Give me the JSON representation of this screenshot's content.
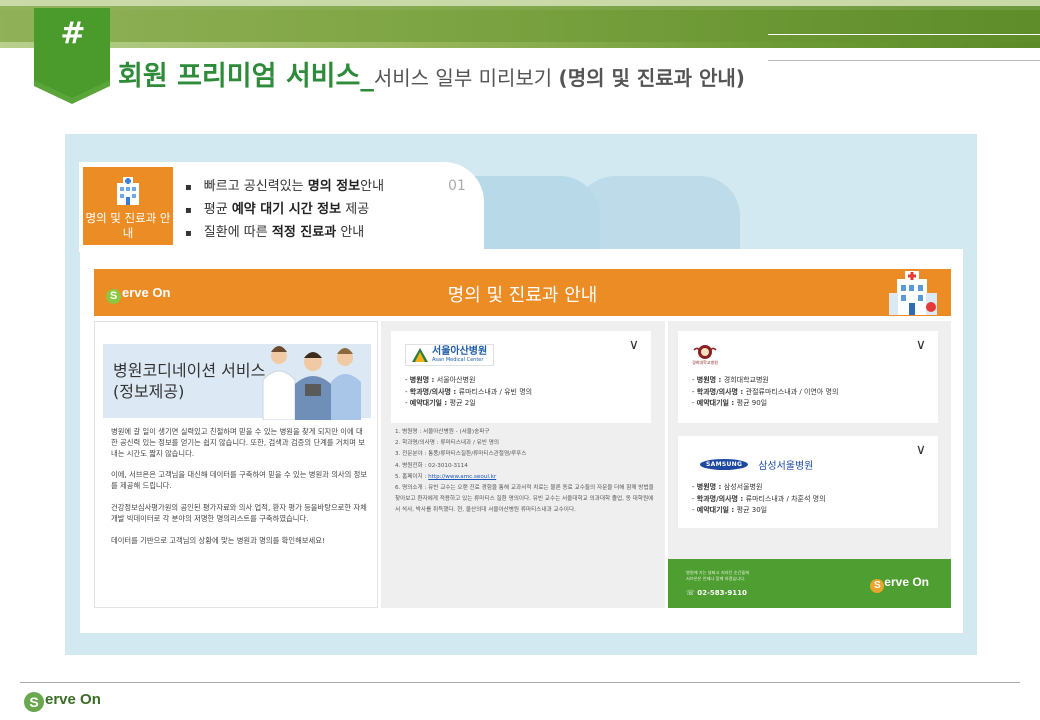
{
  "header": {
    "hash": "#",
    "title_main": "회원 프리미엄 서비스_",
    "title_sub": "서비스 일부 미리보기 ",
    "title_paren": "(명의 및 진료과 안내)"
  },
  "feature": {
    "box_label": "명의 및 진료과 안내",
    "number": "01",
    "bullets": [
      {
        "pre": "빠르고 공신력있는 ",
        "bold": "명의 정보",
        "post": "안내"
      },
      {
        "pre": "평균 ",
        "bold": "예약 대기 시간 정보",
        "post": " 제공"
      },
      {
        "pre": "질환에 따른 ",
        "bold": "적정 진료과",
        "post": " 안내"
      }
    ]
  },
  "preview": {
    "brand": "Serve On",
    "brand_initial": "S",
    "brand_rest": "erve On",
    "bar_title": "명의 및 진료과 안내",
    "service": {
      "title_line1": "병원코디네이션 서비스",
      "title_line2": "(정보제공)",
      "paragraphs": [
        "병원에 갈 일이 생기면 실력있고 친절하며 믿을 수 있는 병원을 찾게 되지만 이에 대한 공신력 있는 정보를 얻기는 쉽지 않습니다. 또한, 검색과 검증의 단계를 거치며 보내는 시간도 짧지 않습니다.",
        "이에, 서브온은 고객님을 대신해 데이터를 구축하여 믿을 수 있는 병원과 의사의 정보를 제공해 드립니다.",
        "건강정보심사평가원의 공인된 평가자료와 의사 업적, 환자 평가 등을바탕으로한 자체개발 빅데이터로 각 분야의 저명한 명의리스트를 구축하였습니다.",
        "데이터를 기반으로 고객님의 상황에 맞는 병원과 명의를 확인해보세요!"
      ]
    },
    "asan": {
      "logo_name": "서울아산병원",
      "logo_en": "Asan Medical Center",
      "info": [
        {
          "label": "병원명 : ",
          "value": "서울아산병원"
        },
        {
          "label": "학과명/의사명 : ",
          "value": "류마티스내과 / 유빈 명의"
        },
        {
          "label": "예약대기일 : ",
          "value": "평균 2일"
        }
      ],
      "details": [
        "1. 병원명 : 서울아산병원 - (서울)송파구",
        "2. 학과명/의사명 : 류마티스내과 / 유빈 명의",
        "3. 전문분야 : 통풍/류마티스질환/류마티스관절염/루푸스",
        "4. 병원전화 : 02-3010-3114"
      ],
      "homepage_label": "5. 홈페이지 : ",
      "homepage_url": "http://www.amc.seoul.kr",
      "intro": "6. 명의소개 : 유빈 교수는 오랜 진료 경험을 통해 교과서적 치료는 물론 동료 교수들의 자문을 더해 함께 방법을 찾아보고 환자에게 적용하고 있는 류마티스 질환 명의이다. 유빈 교수는 서울대학교 의과대학 졸업, 동 대학원에서 석사, 박사를 취득했다. 현, 울산의대 서울아산병원 류마티스내과 교수이다."
    },
    "khu": {
      "logo_text": "경희대학교병원",
      "info": [
        {
          "label": "병원명 : ",
          "value": "경희대학교병원"
        },
        {
          "label": "학과명/의사명 : ",
          "value": "관절류마티스내과 / 이연아 명의"
        },
        {
          "label": "예약대기일 : ",
          "value": "평균 90일"
        }
      ]
    },
    "samsung": {
      "logo_oval": "SAMSUNG",
      "logo_name": "삼성서울병원",
      "info": [
        {
          "label": "병원명 : ",
          "value": "삼성서울병원"
        },
        {
          "label": "학과명/의사명 : ",
          "value": "류마티스내과 / 차훈석 명의"
        },
        {
          "label": "예약대기일 : ",
          "value": "평균 30일"
        }
      ]
    },
    "contact": {
      "line1": "병원에 가는 날짜고 지라던 순간들에",
      "line2": "서브온은 언제나 함께 하겠습니다.",
      "phone": "02-583-9110"
    },
    "chevron": "∨"
  },
  "footer": {
    "initial": "S",
    "rest": "erve On"
  },
  "colors": {
    "accent_green": "#2e8b3a",
    "orange": "#ec8c25",
    "panel_blue": "#d3e9f2",
    "contact_green": "#4f9e32"
  }
}
